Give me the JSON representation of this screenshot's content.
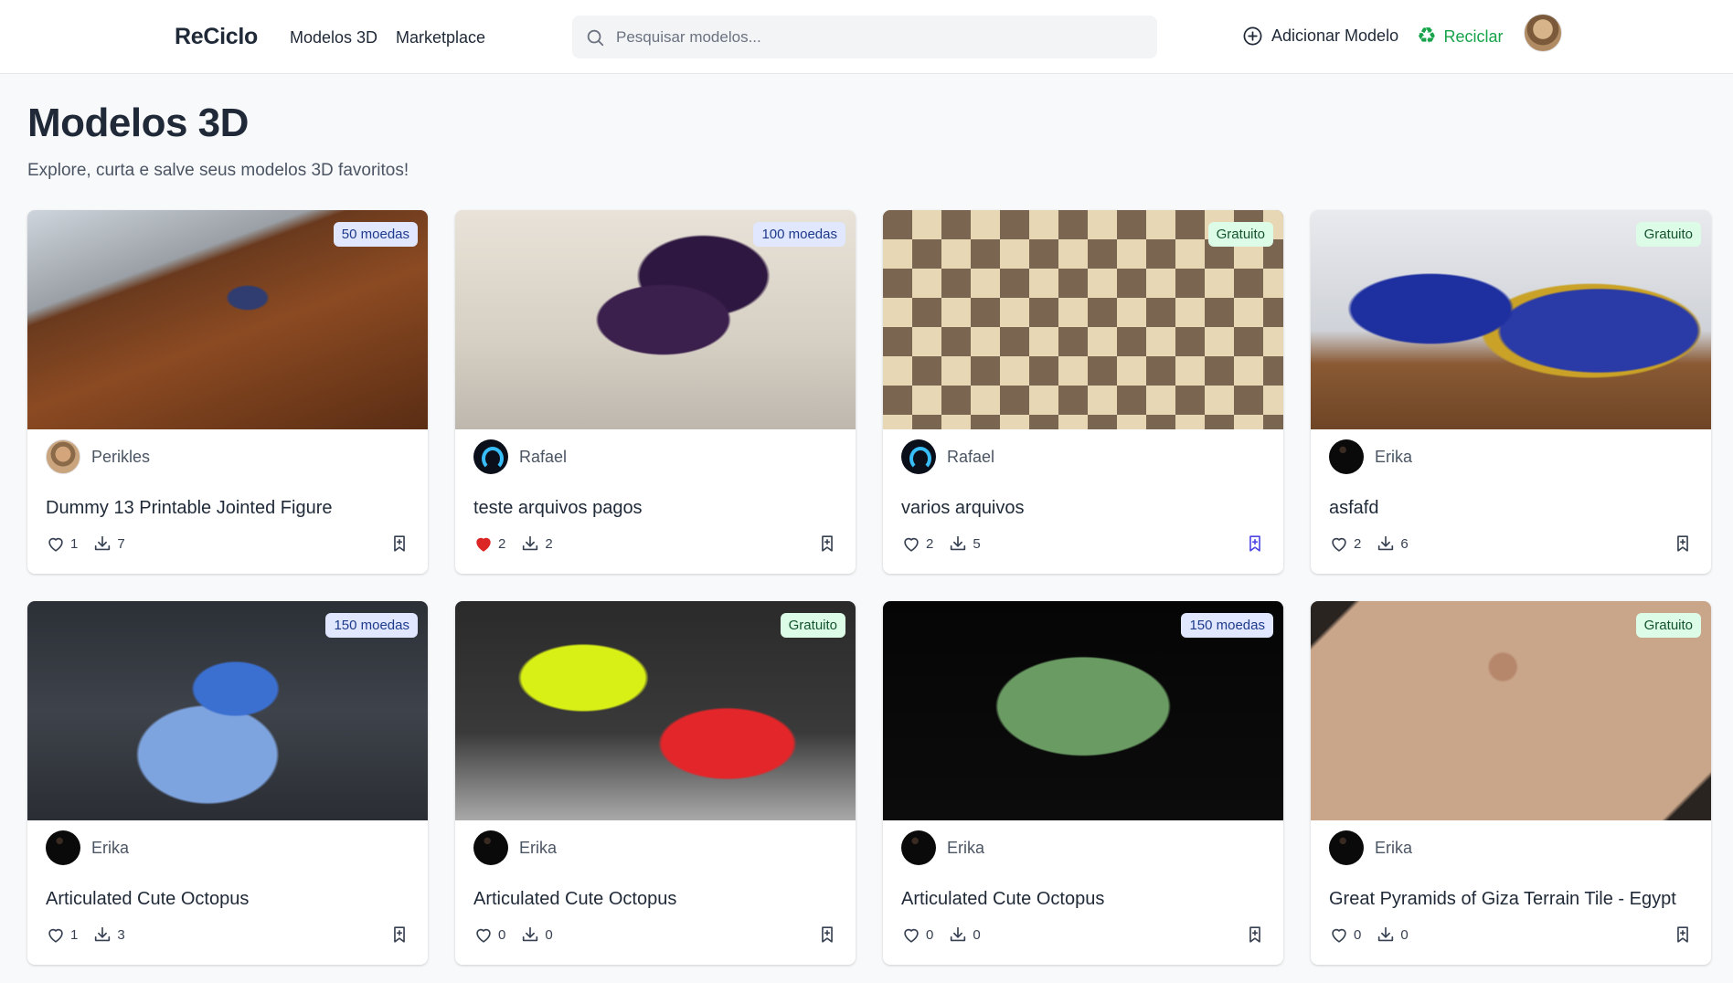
{
  "header": {
    "brand": "ReCiclo",
    "nav": [
      "Modelos 3D",
      "Marketplace"
    ],
    "search_placeholder": "Pesquisar modelos...",
    "add_model_label": "Adicionar Modelo",
    "recycle_label": "Reciclar",
    "recycle_icon": "recycle-icon",
    "colors": {
      "recycle": "#16a34a"
    }
  },
  "page": {
    "title": "Modelos 3D",
    "subtitle": "Explore, curta e salve seus modelos 3D favoritos!"
  },
  "cards": [
    {
      "price": "50 moedas",
      "price_type": "paid",
      "author": "Perikles",
      "title": "Dummy 13 Printable Jointed Figure",
      "likes": "1",
      "downloads": "7",
      "liked": false,
      "saved": false
    },
    {
      "price": "100 moedas",
      "price_type": "paid",
      "author": "Rafael",
      "title": "teste arquivos pagos",
      "likes": "2",
      "downloads": "2",
      "liked": true,
      "saved": false
    },
    {
      "price": "Gratuito",
      "price_type": "free",
      "author": "Rafael",
      "title": "varios arquivos",
      "likes": "2",
      "downloads": "5",
      "liked": false,
      "saved": true
    },
    {
      "price": "Gratuito",
      "price_type": "free",
      "author": "Erika",
      "title": "asfafd",
      "likes": "2",
      "downloads": "6",
      "liked": false,
      "saved": false
    },
    {
      "price": "150 moedas",
      "price_type": "paid",
      "author": "Erika",
      "title": "Articulated Cute Octopus",
      "likes": "1",
      "downloads": "3",
      "liked": false,
      "saved": false
    },
    {
      "price": "Gratuito",
      "price_type": "free",
      "author": "Erika",
      "title": "Articulated Cute Octopus",
      "likes": "0",
      "downloads": "0",
      "liked": false,
      "saved": false
    },
    {
      "price": "150 moedas",
      "price_type": "paid",
      "author": "Erika",
      "title": "Articulated Cute Octopus",
      "likes": "0",
      "downloads": "0",
      "liked": false,
      "saved": false
    },
    {
      "price": "Gratuito",
      "price_type": "free",
      "author": "Erika",
      "title": "Great Pyramids of Giza Terrain Tile - Egypt",
      "likes": "0",
      "downloads": "0",
      "liked": false,
      "saved": false
    }
  ]
}
